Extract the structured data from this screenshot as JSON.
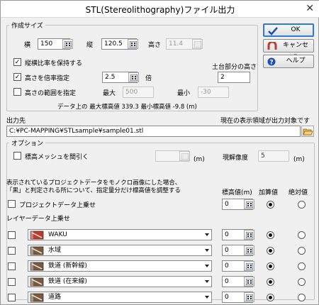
{
  "window": {
    "title": "STL(Stereolithography)ファイル出力",
    "close_glyph": "✕"
  },
  "create_size": {
    "group_label": "作成サイズ",
    "width_label": "横",
    "width_value": "150",
    "height_label": "縦",
    "height_value": "120.5",
    "alt_label": "高さ",
    "alt_value": "11.4",
    "keep_ratio_label": "縦横比率を保持する",
    "keep_ratio_checked": true,
    "scale_label": "高さを倍率指定",
    "scale_checked": true,
    "scale_value": "2.5",
    "scale_unit": "倍",
    "range_label": "高さの範囲を指定",
    "range_checked": false,
    "max_label": "最大",
    "max_value": "500",
    "min_label": "最小",
    "min_value": "-30",
    "base_label": "土台部分の高さ",
    "base_value": "2",
    "info_text": "データ上の 最大標高値 339.3  最小標高値 -9.8 (m)"
  },
  "buttons": {
    "ok": "OK",
    "cancel": "キャンセル",
    "help": "ヘルプ"
  },
  "output": {
    "label": "出力先",
    "note": "現在の表示領域が出力対象です",
    "path": "C:¥PC-MAPPING¥STLsample¥sample01.stl"
  },
  "options": {
    "group_label": "オプション",
    "thin_mesh_label": "標高メッシュを間引く",
    "thin_mesh_checked": false,
    "thin_mesh_unit": "(m)",
    "resolution_label": "現解像度",
    "resolution_value": "5",
    "resolution_unit": "(m)",
    "desc_line1": "表示されているプロジェクトデータをモノクロ画像にした場合、",
    "desc_line2": "「黒」と判定される所について、指定量分だけ標高値を調整する",
    "col_elev": "標高値(m)",
    "col_add": "加算値",
    "col_abs": "絶対値",
    "project_overlay_label": "プロジェクトデータ上乗せ",
    "project_overlay_checked": false,
    "project_value": "0",
    "layer_overlay_label": "レイヤーデータ上乗せ",
    "layers": [
      {
        "name": "WAKU",
        "value": "0",
        "mode": "add",
        "icon_color": "#c0392b"
      },
      {
        "name": "水域",
        "value": "0",
        "mode": "add",
        "icon_color": "#7a5a3a"
      },
      {
        "name": "鉄道 (新幹線)",
        "value": "0",
        "mode": "add",
        "icon_color": "#7a5a3a"
      },
      {
        "name": "鉄道 (在来線)",
        "value": "0",
        "mode": "add",
        "icon_color": "#7a5a3a"
      },
      {
        "name": "道路",
        "value": "0",
        "mode": "add",
        "icon_color": "#7a5a3a"
      }
    ]
  },
  "icons": {
    "ok": "checkmark-icon",
    "cancel": "magnet-icon",
    "help": "question-icon",
    "calc": "calculator-icon",
    "folder": "folder-open-icon",
    "layer": "layer-book-icon"
  }
}
